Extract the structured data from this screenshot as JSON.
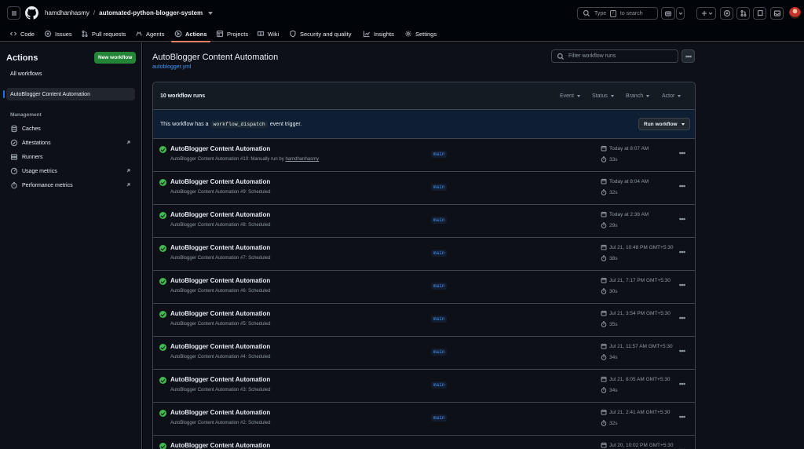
{
  "header": {
    "owner": "hamdhanhasmy",
    "separator": "/",
    "repo": "automated-python-blogger-system",
    "search_prefix": "Type",
    "search_key": "/",
    "search_suffix": "to search"
  },
  "tabs": [
    {
      "label": "Code",
      "icon": "code-icon"
    },
    {
      "label": "Issues",
      "icon": "issue-icon"
    },
    {
      "label": "Pull requests",
      "icon": "pull-request-icon"
    },
    {
      "label": "Agents",
      "icon": "agent-icon"
    },
    {
      "label": "Actions",
      "icon": "play-icon",
      "active": true
    },
    {
      "label": "Projects",
      "icon": "table-icon"
    },
    {
      "label": "Wiki",
      "icon": "book-icon"
    },
    {
      "label": "Security and quality",
      "icon": "shield-icon"
    },
    {
      "label": "Insights",
      "icon": "graph-icon"
    },
    {
      "label": "Settings",
      "icon": "gear-icon"
    }
  ],
  "sidebar": {
    "title": "Actions",
    "new_workflow": "New workflow",
    "all_workflows": "All workflows",
    "selected_workflow": "AutoBlogger Content Automation",
    "management_heading": "Management",
    "management_items": [
      {
        "label": "Caches",
        "icon": "database-icon",
        "external": false
      },
      {
        "label": "Attestations",
        "icon": "verified-icon",
        "external": true
      },
      {
        "label": "Runners",
        "icon": "server-icon",
        "external": false
      },
      {
        "label": "Usage metrics",
        "icon": "meter-icon",
        "external": true
      },
      {
        "label": "Performance metrics",
        "icon": "stopwatch-icon",
        "external": true
      }
    ]
  },
  "main": {
    "title": "AutoBlogger Content Automation",
    "file": "autoblogger.yml",
    "filter_placeholder": "Filter workflow runs",
    "runs_count": "10 workflow runs",
    "filters": [
      "Event",
      "Status",
      "Branch",
      "Actor"
    ],
    "dispatch_prefix": "This workflow has a",
    "dispatch_code": "workflow_dispatch",
    "dispatch_suffix": "event trigger.",
    "run_workflow": "Run workflow"
  },
  "runs": [
    {
      "name": "AutoBlogger Content Automation",
      "sub": "AutoBlogger Content Automation #10: Manually run by",
      "actor": "hamdhanhasmy",
      "branch": "main",
      "date": "Today at 8:07 AM",
      "duration": "33s"
    },
    {
      "name": "AutoBlogger Content Automation",
      "sub": "AutoBlogger Content Automation #9: Scheduled",
      "actor": "",
      "branch": "main",
      "date": "Today at 8:04 AM",
      "duration": "32s"
    },
    {
      "name": "AutoBlogger Content Automation",
      "sub": "AutoBlogger Content Automation #8: Scheduled",
      "actor": "",
      "branch": "main",
      "date": "Today at 2:38 AM",
      "duration": "29s"
    },
    {
      "name": "AutoBlogger Content Automation",
      "sub": "AutoBlogger Content Automation #7: Scheduled",
      "actor": "",
      "branch": "main",
      "date": "Jul 21, 10:48 PM GMT+5:30",
      "duration": "38s"
    },
    {
      "name": "AutoBlogger Content Automation",
      "sub": "AutoBlogger Content Automation #6: Scheduled",
      "actor": "",
      "branch": "main",
      "date": "Jul 21, 7:17 PM GMT+5:30",
      "duration": "30s"
    },
    {
      "name": "AutoBlogger Content Automation",
      "sub": "AutoBlogger Content Automation #5: Scheduled",
      "actor": "",
      "branch": "main",
      "date": "Jul 21, 3:54 PM GMT+5:30",
      "duration": "35s"
    },
    {
      "name": "AutoBlogger Content Automation",
      "sub": "AutoBlogger Content Automation #4: Scheduled",
      "actor": "",
      "branch": "main",
      "date": "Jul 21, 11:57 AM GMT+5:30",
      "duration": "34s"
    },
    {
      "name": "AutoBlogger Content Automation",
      "sub": "AutoBlogger Content Automation #3: Scheduled",
      "actor": "",
      "branch": "main",
      "date": "Jul 21, 8:05 AM GMT+5:30",
      "duration": "34s"
    },
    {
      "name": "AutoBlogger Content Automation",
      "sub": "AutoBlogger Content Automation #2: Scheduled",
      "actor": "",
      "branch": "main",
      "date": "Jul 21, 2:41 AM GMT+5:30",
      "duration": "32s"
    },
    {
      "name": "AutoBlogger Content Automation",
      "sub": "",
      "actor": "",
      "branch": "",
      "date": "Jul 20, 10:02 PM GMT+5:30",
      "duration": ""
    }
  ],
  "colors": {
    "accent": "#f78166",
    "success": "#3fb950",
    "link": "#4493f8",
    "primary_button": "#238636",
    "background": "#0d1117"
  }
}
